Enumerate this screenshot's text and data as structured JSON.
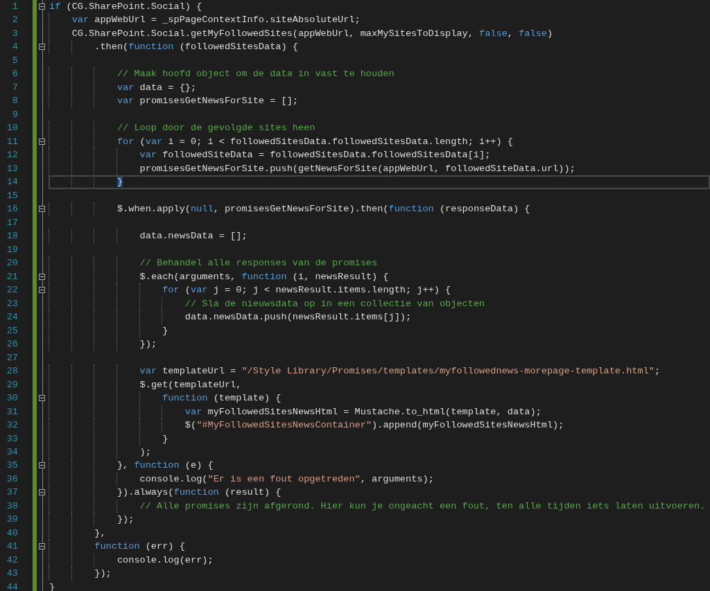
{
  "editor": {
    "lines": [
      {
        "number": "1",
        "changed": true,
        "fold": true,
        "current": false,
        "tokens": [
          {
            "text": "if",
            "kind": "keyword"
          },
          {
            "text": " (CG.SharePoint.Social) {",
            "kind": "plain"
          }
        ]
      },
      {
        "number": "2",
        "changed": true,
        "fold": false,
        "current": false,
        "tokens": [
          {
            "text": "    var",
            "kind": "keyword"
          },
          {
            "text": " appWebUrl = _spPageContextInfo.siteAbsoluteUrl;",
            "kind": "plain"
          }
        ]
      },
      {
        "number": "3",
        "changed": true,
        "fold": false,
        "current": false,
        "tokens": [
          {
            "text": "    CG.SharePoint.Social.getMyFollowedSites(appWebUrl, maxMySitesToDisplay, ",
            "kind": "plain"
          },
          {
            "text": "false",
            "kind": "keyword"
          },
          {
            "text": ", ",
            "kind": "plain"
          },
          {
            "text": "false",
            "kind": "keyword"
          },
          {
            "text": ")",
            "kind": "plain"
          }
        ]
      },
      {
        "number": "4",
        "changed": true,
        "fold": true,
        "current": false,
        "tokens": [
          {
            "text": "        .then(",
            "kind": "plain"
          },
          {
            "text": "function",
            "kind": "keyword"
          },
          {
            "text": " (followedSitesData) {",
            "kind": "plain"
          }
        ]
      },
      {
        "number": "5",
        "changed": true,
        "fold": false,
        "current": false
      },
      {
        "number": "6",
        "changed": true,
        "fold": false,
        "current": false,
        "tokens": [
          {
            "text": "            // Maak hoofd object om de data in vast te houden",
            "kind": "comment"
          }
        ]
      },
      {
        "number": "7",
        "changed": true,
        "fold": false,
        "current": false,
        "tokens": [
          {
            "text": "            var",
            "kind": "keyword"
          },
          {
            "text": " data = {};",
            "kind": "plain"
          }
        ]
      },
      {
        "number": "8",
        "changed": true,
        "fold": false,
        "current": false,
        "tokens": [
          {
            "text": "            var",
            "kind": "keyword"
          },
          {
            "text": " promisesGetNewsForSite = [];",
            "kind": "plain"
          }
        ]
      },
      {
        "number": "9",
        "changed": true,
        "fold": false,
        "current": false
      },
      {
        "number": "10",
        "changed": true,
        "fold": false,
        "current": false,
        "tokens": [
          {
            "text": "            // Loop door de gevolgde sites heen",
            "kind": "comment"
          }
        ]
      },
      {
        "number": "11",
        "changed": true,
        "fold": true,
        "current": false,
        "tokens": [
          {
            "text": "            for",
            "kind": "keyword"
          },
          {
            "text": " (",
            "kind": "plain"
          },
          {
            "text": "var",
            "kind": "keyword"
          },
          {
            "text": " i = 0; i < followedSitesData.followedSitesData.length; i++) {",
            "kind": "plain"
          }
        ]
      },
      {
        "number": "12",
        "changed": true,
        "fold": false,
        "current": false,
        "tokens": [
          {
            "text": "                var",
            "kind": "keyword"
          },
          {
            "text": " followedSiteData = followedSitesData.followedSitesData[i];",
            "kind": "plain"
          }
        ]
      },
      {
        "number": "13",
        "changed": true,
        "fold": false,
        "current": false,
        "tokens": [
          {
            "text": "                promisesGetNewsForSite.push(getNewsForSite(appWebUrl, followedSiteData.url));",
            "kind": "plain"
          }
        ]
      },
      {
        "number": "14",
        "changed": true,
        "fold": false,
        "current": true,
        "tokens": [
          {
            "text": "            }",
            "kind": "brace-match"
          }
        ]
      },
      {
        "number": "15",
        "changed": true,
        "fold": false,
        "current": false
      },
      {
        "number": "16",
        "changed": true,
        "fold": true,
        "current": false,
        "tokens": [
          {
            "text": "            $.when.apply(",
            "kind": "plain"
          },
          {
            "text": "null",
            "kind": "keyword"
          },
          {
            "text": ", promisesGetNewsForSite).then(",
            "kind": "plain"
          },
          {
            "text": "function",
            "kind": "keyword"
          },
          {
            "text": " (responseData) {",
            "kind": "plain"
          }
        ]
      },
      {
        "number": "17",
        "changed": true,
        "fold": false,
        "current": false
      },
      {
        "number": "18",
        "changed": true,
        "fold": false,
        "current": false,
        "tokens": [
          {
            "text": "                data.newsData = [];",
            "kind": "plain"
          }
        ]
      },
      {
        "number": "19",
        "changed": true,
        "fold": false,
        "current": false
      },
      {
        "number": "20",
        "changed": true,
        "fold": false,
        "current": false,
        "tokens": [
          {
            "text": "                // Behandel alle responses van de promises",
            "kind": "comment"
          }
        ]
      },
      {
        "number": "21",
        "changed": true,
        "fold": true,
        "current": false,
        "tokens": [
          {
            "text": "                $.each(arguments, ",
            "kind": "plain"
          },
          {
            "text": "function",
            "kind": "keyword"
          },
          {
            "text": " (i, newsResult) {",
            "kind": "plain"
          }
        ]
      },
      {
        "number": "22",
        "changed": true,
        "fold": true,
        "current": false,
        "tokens": [
          {
            "text": "                    for",
            "kind": "keyword"
          },
          {
            "text": " (",
            "kind": "plain"
          },
          {
            "text": "var",
            "kind": "keyword"
          },
          {
            "text": " j = 0; j < newsResult.items.length; j++) {",
            "kind": "plain"
          }
        ]
      },
      {
        "number": "23",
        "changed": true,
        "fold": false,
        "current": false,
        "tokens": [
          {
            "text": "                        // Sla de nieuwsdata op in een collectie van objecten",
            "kind": "comment"
          }
        ]
      },
      {
        "number": "24",
        "changed": true,
        "fold": false,
        "current": false,
        "tokens": [
          {
            "text": "                        data.newsData.push(newsResult.items[j]);",
            "kind": "plain"
          }
        ]
      },
      {
        "number": "25",
        "changed": true,
        "fold": false,
        "current": false,
        "tokens": [
          {
            "text": "                    }",
            "kind": "plain"
          }
        ]
      },
      {
        "number": "26",
        "changed": true,
        "fold": false,
        "current": false,
        "tokens": [
          {
            "text": "                });",
            "kind": "plain"
          }
        ]
      },
      {
        "number": "27",
        "changed": true,
        "fold": false,
        "current": false
      },
      {
        "number": "28",
        "changed": true,
        "fold": false,
        "current": false,
        "tokens": [
          {
            "text": "                var",
            "kind": "keyword"
          },
          {
            "text": " templateUrl = ",
            "kind": "plain"
          },
          {
            "text": "\"/Style Library/Promises/templates/myfollowednews-morepage-template.html\"",
            "kind": "string"
          },
          {
            "text": ";",
            "kind": "plain"
          }
        ]
      },
      {
        "number": "29",
        "changed": true,
        "fold": false,
        "current": false,
        "tokens": [
          {
            "text": "                $.get(templateUrl,",
            "kind": "plain"
          }
        ]
      },
      {
        "number": "30",
        "changed": true,
        "fold": true,
        "current": false,
        "tokens": [
          {
            "text": "                    function",
            "kind": "keyword"
          },
          {
            "text": " (template) {",
            "kind": "plain"
          }
        ]
      },
      {
        "number": "31",
        "changed": true,
        "fold": false,
        "current": false,
        "tokens": [
          {
            "text": "                        var",
            "kind": "keyword"
          },
          {
            "text": " myFollowedSitesNewsHtml = Mustache.to_html(template, data);",
            "kind": "plain"
          }
        ]
      },
      {
        "number": "32",
        "changed": true,
        "fold": false,
        "current": false,
        "tokens": [
          {
            "text": "                        $(",
            "kind": "plain"
          },
          {
            "text": "\"#MyFollowedSitesNewsContainer\"",
            "kind": "string"
          },
          {
            "text": ").append(myFollowedSitesNewsHtml);",
            "kind": "plain"
          }
        ]
      },
      {
        "number": "33",
        "changed": true,
        "fold": false,
        "current": false,
        "tokens": [
          {
            "text": "                    }",
            "kind": "plain"
          }
        ]
      },
      {
        "number": "34",
        "changed": true,
        "fold": false,
        "current": false,
        "tokens": [
          {
            "text": "                );",
            "kind": "plain"
          }
        ]
      },
      {
        "number": "35",
        "changed": true,
        "fold": true,
        "current": false,
        "tokens": [
          {
            "text": "            }, ",
            "kind": "plain"
          },
          {
            "text": "function",
            "kind": "keyword"
          },
          {
            "text": " (e) {",
            "kind": "plain"
          }
        ]
      },
      {
        "number": "36",
        "changed": true,
        "fold": false,
        "current": false,
        "tokens": [
          {
            "text": "                console.log(",
            "kind": "plain"
          },
          {
            "text": "\"Er is een fout opgetreden\"",
            "kind": "string"
          },
          {
            "text": ", arguments);",
            "kind": "plain"
          }
        ]
      },
      {
        "number": "37",
        "changed": true,
        "fold": true,
        "current": false,
        "tokens": [
          {
            "text": "            }).always(",
            "kind": "plain"
          },
          {
            "text": "function",
            "kind": "keyword"
          },
          {
            "text": " (result) {",
            "kind": "plain"
          }
        ]
      },
      {
        "number": "38",
        "changed": true,
        "fold": false,
        "current": false,
        "tokens": [
          {
            "text": "                // Alle promises zijn afgerond. Hier kun je ongeacht een fout, ten alle tijden iets laten uitvoeren.",
            "kind": "comment"
          }
        ]
      },
      {
        "number": "39",
        "changed": true,
        "fold": false,
        "current": false,
        "tokens": [
          {
            "text": "            });",
            "kind": "plain"
          }
        ]
      },
      {
        "number": "40",
        "changed": true,
        "fold": false,
        "current": false,
        "tokens": [
          {
            "text": "        },",
            "kind": "plain"
          }
        ]
      },
      {
        "number": "41",
        "changed": true,
        "fold": true,
        "current": false,
        "tokens": [
          {
            "text": "        function",
            "kind": "keyword"
          },
          {
            "text": " (err) {",
            "kind": "plain"
          }
        ]
      },
      {
        "number": "42",
        "changed": true,
        "fold": false,
        "current": false,
        "tokens": [
          {
            "text": "            console.log(err);",
            "kind": "plain"
          }
        ]
      },
      {
        "number": "43",
        "changed": true,
        "fold": false,
        "current": false,
        "tokens": [
          {
            "text": "        });",
            "kind": "plain"
          }
        ]
      },
      {
        "number": "44",
        "changed": true,
        "fold": false,
        "current": false,
        "tokens": [
          {
            "text": "}",
            "kind": "plain"
          }
        ]
      }
    ]
  }
}
